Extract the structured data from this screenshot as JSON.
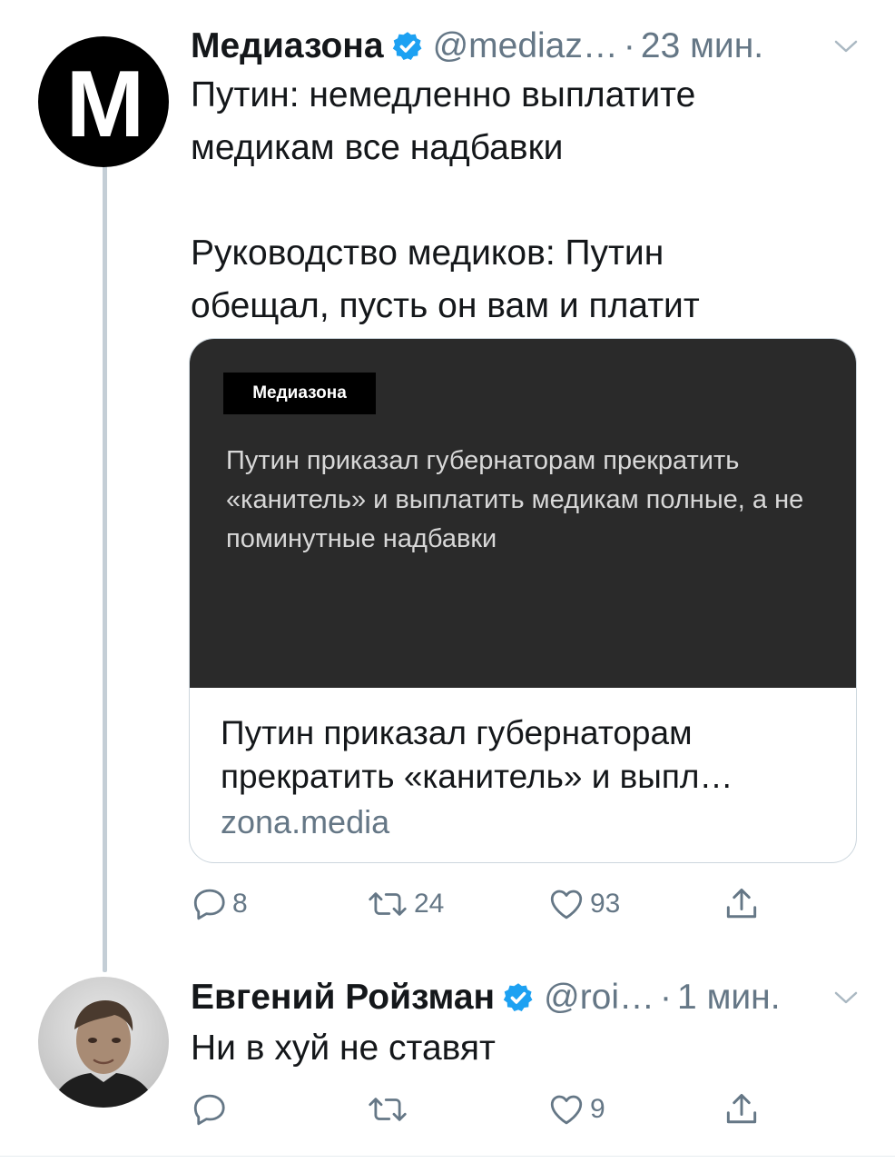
{
  "colors": {
    "accent": "#1da1f2",
    "muted": "#657786",
    "text": "#14171a",
    "thread_line": "#c4ced6"
  },
  "tweets": [
    {
      "avatar_letter": "M",
      "name": "Медиазона",
      "handle": "@mediaz…",
      "separator": "·",
      "time": "23 мин.",
      "text": "Путин: немедленно выплатите\nмедикам все надбавки\n\nРуководство медиков: Путин\nобещал, пусть он вам и платит",
      "card": {
        "brand": "Медиазона",
        "image_text": "Путин приказал губернаторам прекратить «канитель» и выплатить медикам полные, а не поминутные надбавки",
        "title": "Путин приказал губернаторам прекратить «канитель» и выпл…",
        "domain": "zona.media"
      },
      "actions": {
        "replies": "8",
        "retweets": "24",
        "likes": "93"
      }
    },
    {
      "name": "Евгений Ройзман",
      "handle": "@roi…",
      "separator": "·",
      "time": "1 мин.",
      "text": "Ни в хуй не ставят",
      "actions": {
        "replies": "",
        "retweets": "",
        "likes": "9"
      }
    }
  ]
}
